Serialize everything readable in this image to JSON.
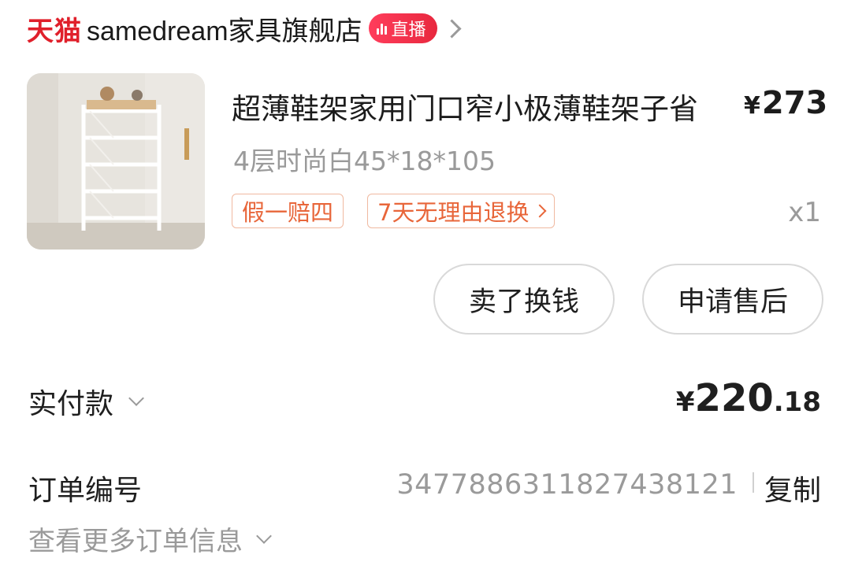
{
  "shop": {
    "platform_logo": "天猫",
    "name": "samedream家具旗舰店",
    "live_badge": "直播",
    "accent_color": "#e0202b"
  },
  "product": {
    "title": "超薄鞋架家用门口窄小极薄鞋架子省",
    "currency": "¥",
    "price": "273",
    "spec": "4层时尚白45*18*105",
    "tags": [
      "假一赔四",
      "7天无理由退换"
    ],
    "quantity": "x1"
  },
  "actions": {
    "sell": "卖了换钱",
    "after_sales": "申请售后"
  },
  "payment": {
    "label": "实付款",
    "currency": "¥",
    "amount_int": "220",
    "amount_dec": ".18"
  },
  "order": {
    "label": "订单编号",
    "number": "3477886311827438121",
    "copy": "复制",
    "more": "查看更多订单信息"
  }
}
